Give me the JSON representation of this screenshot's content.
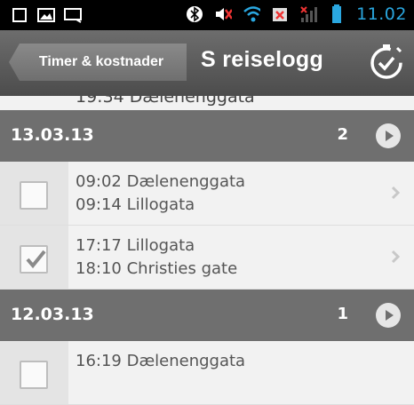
{
  "status_bar": {
    "icons": [
      "notification-square-icon",
      "image-icon",
      "message-icon",
      "bluetooth-icon",
      "muted-speaker-icon",
      "wifi-icon",
      "battery-alert-icon",
      "signal-icon",
      "battery-icon"
    ],
    "time": "11.02"
  },
  "action_bar": {
    "back_label": "Timer & kostnader",
    "title": "S reiselogg",
    "right_icon": "timer-check-icon"
  },
  "list": {
    "partial_top_text": "19:34 Dælenenggata",
    "groups": [
      {
        "date": "13.03.13",
        "count": "2",
        "trips": [
          {
            "line1": "09:02 Dælenenggata",
            "line2": "09:14 Lillogata",
            "checked": false
          },
          {
            "line1": "17:17 Lillogata",
            "line2": "18:10 Christies gate",
            "checked": true
          }
        ]
      },
      {
        "date": "12.03.13",
        "count": "1",
        "trips": [
          {
            "line1": "16:19 Dælenenggata",
            "line2": "",
            "checked": false
          }
        ]
      }
    ]
  },
  "colors": {
    "status_time": "#2aa7e0",
    "header_bg": "#6f6f6f",
    "actionbar_bg": "#5c5c5c"
  }
}
